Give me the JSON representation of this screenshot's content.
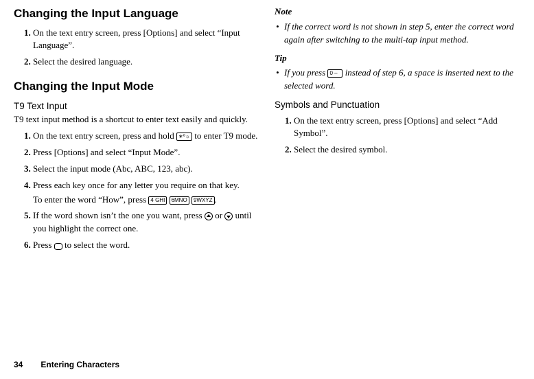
{
  "left": {
    "h1": "Changing the Input Language",
    "ol1": {
      "i1": "On the text entry screen, press [Options] and select “Input Language”.",
      "i2": "Select the desired language."
    },
    "h2": "Changing the Input Mode",
    "sub1": "T9 Text Input",
    "p1": "T9 text input method is a shortcut to enter text easily and quickly.",
    "ol2": {
      "i1a": "On the text entry screen, press and hold ",
      "i1b": " to enter T9 mode.",
      "i2": "Press [Options] and select “Input Mode”.",
      "i3": "Select the input mode (Abc, ABC, 123, abc).",
      "i4a": "Press each key once for any letter you require on that key.",
      "i4b_a": "To enter the word “How”, press ",
      "i5a": "If the word shown isn’t the one you want, press ",
      "i5b": " or ",
      "i5c": " until you highlight the correct one.",
      "i6a": "Press ",
      "i6b": " to select the word."
    }
  },
  "right": {
    "noteHead": "Note",
    "noteItem": "If the correct word is not shown in step 5, enter the correct word again after switching to the multi-tap input method.",
    "tipHead": "Tip",
    "tipA": "If you press ",
    "tipB": " instead of step 6, a space is inserted next to the selected word.",
    "sub2": "Symbols and Punctuation",
    "ol3": {
      "i1": "On the text entry screen, press [Options] and select “Add Symbol”.",
      "i2": "Select the desired symbol."
    }
  },
  "keys": {
    "star": "∗º☼",
    "k4": "4 GHI",
    "k6": "6MNO",
    "k9": "9WXYZ",
    "k0": "0 –"
  },
  "footer": {
    "page": "34",
    "section": "Entering Characters"
  }
}
